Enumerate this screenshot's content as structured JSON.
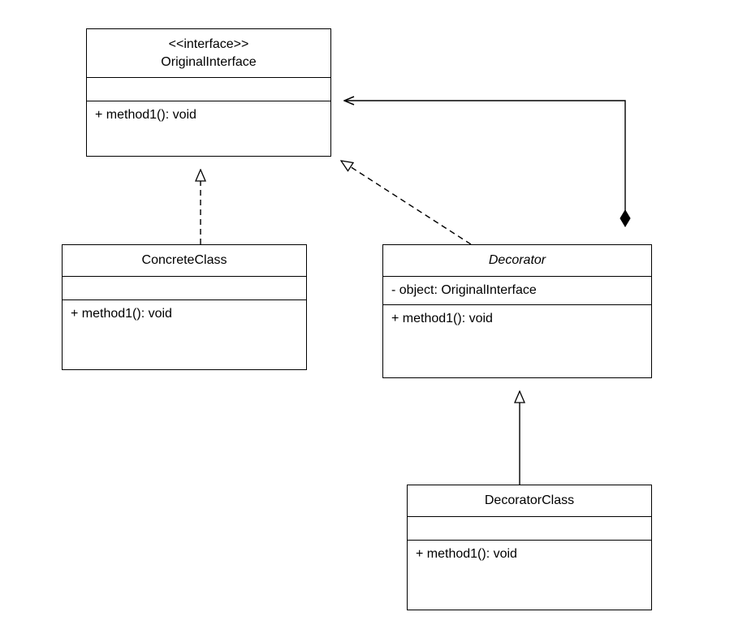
{
  "classes": {
    "interface": {
      "stereotype": "<<interface>>",
      "name": "OriginalInterface",
      "method": "+ method1(): void"
    },
    "concrete": {
      "name": "ConcreteClass",
      "method": "+ method1(): void"
    },
    "decorator": {
      "name": "Decorator",
      "attribute": "- object: OriginalInterface",
      "method": "+ method1(): void"
    },
    "decoratorClass": {
      "name": "DecoratorClass",
      "method": "+ method1(): void"
    }
  }
}
